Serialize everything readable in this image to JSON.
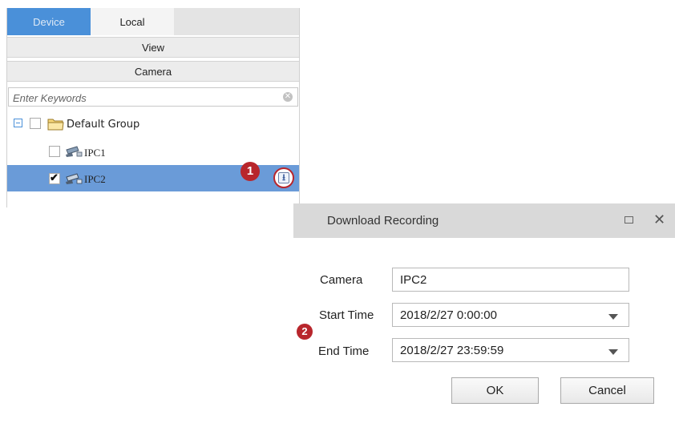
{
  "tabs": {
    "device": "Device",
    "local": "Local"
  },
  "sections": {
    "view": "View",
    "camera": "Camera"
  },
  "search": {
    "placeholder": "Enter Keywords"
  },
  "tree": {
    "group": {
      "label": "Default Group",
      "checked": false,
      "expanded": true
    },
    "items": [
      {
        "label": "IPC1",
        "checked": false,
        "selected": false
      },
      {
        "label": "IPC2",
        "checked": true,
        "selected": true
      }
    ]
  },
  "steps": {
    "one": "1",
    "two": "2"
  },
  "dialog": {
    "title": "Download Recording",
    "camera_label": "Camera",
    "camera_value": "IPC2",
    "start_label": "Start Time",
    "start_value": "2018/2/27 0:00:00",
    "end_label": "End Time",
    "end_value": "2018/2/27 23:59:59",
    "ok_label": "OK",
    "cancel_label": "Cancel"
  },
  "colors": {
    "accent": "#4a90d9",
    "selected_row": "#6a9bd8",
    "step_badge": "#b8262c",
    "dialog_header": "#d9d9d9"
  },
  "icons": [
    "clear-icon",
    "expander-icon",
    "folder-icon",
    "camera-icon",
    "download-icon",
    "maximize-icon",
    "close-icon",
    "dropdown-arrow-icon",
    "check-icon"
  ]
}
